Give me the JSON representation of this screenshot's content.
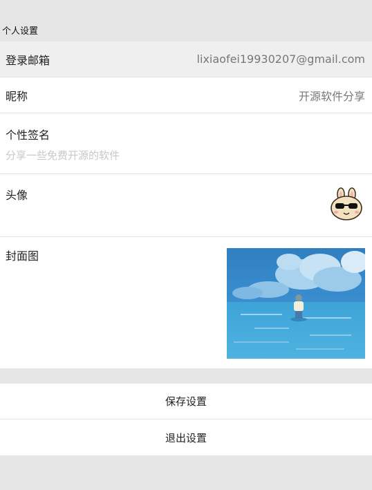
{
  "header": {
    "title": "个人设置"
  },
  "email": {
    "label": "登录邮箱",
    "value": "lixiaofei19930207@gmail.com"
  },
  "nickname": {
    "label": "昵称",
    "value": "开源软件分享"
  },
  "signature": {
    "label": "个性签名",
    "placeholder": "分享一些免费开源的软件"
  },
  "avatar": {
    "label": "头像",
    "icon": "bunny-sunglasses-avatar"
  },
  "cover": {
    "label": "封面图",
    "icon": "sea-clouds-cover-image"
  },
  "actions": {
    "save_label": "保存设置",
    "exit_label": "退出设置"
  }
}
